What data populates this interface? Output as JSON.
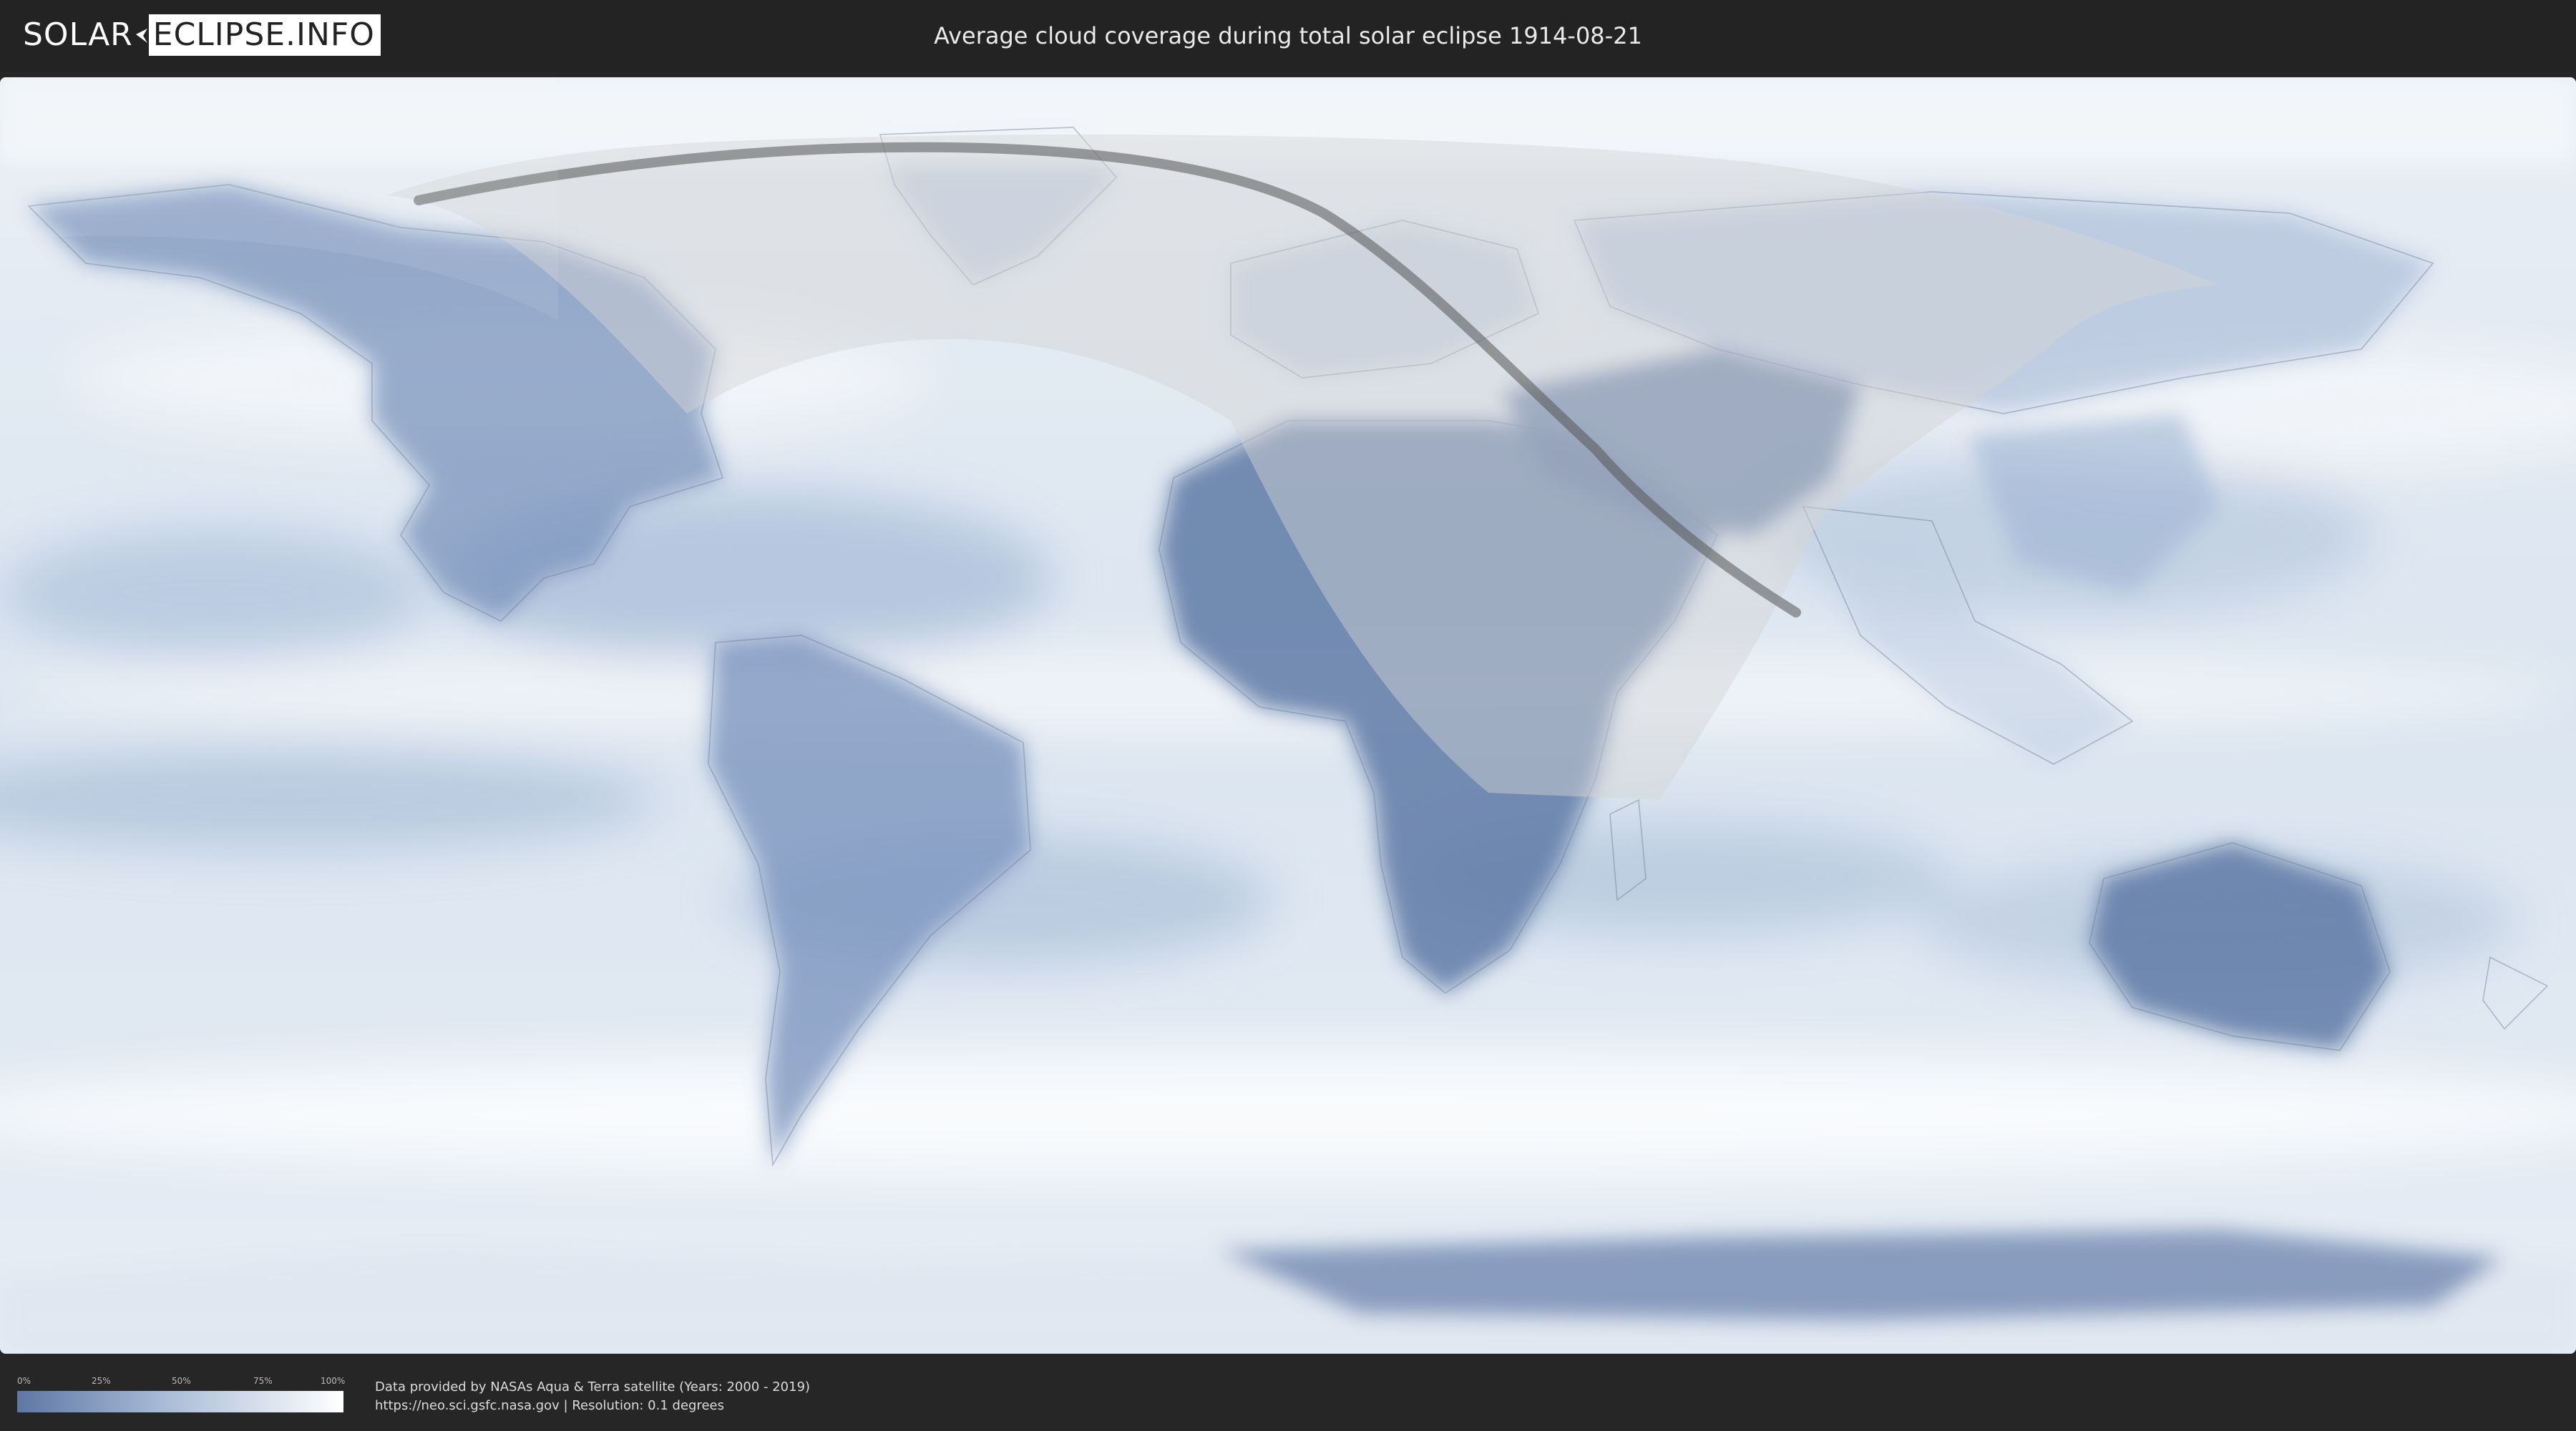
{
  "header": {
    "logo_solar": "SOLAR",
    "logo_eclipse": "ECLIPSE.INFO",
    "title": "Average cloud coverage during total solar eclipse 1914-08-21"
  },
  "map": {
    "projection": "equirectangular",
    "ocean_colour": "#dfe8f2",
    "clear_sky_colour": "#5e77a4",
    "cloud_colour": "#ffffff",
    "eclipse_path_colour": "#555555",
    "visibility_zone_colour": "#dcdcdc"
  },
  "legend": {
    "ticks": [
      "0%",
      "25%",
      "50%",
      "75%",
      "100%"
    ],
    "gradient_from": "#5e77a4",
    "gradient_to": "#ffffff"
  },
  "footer": {
    "credit_line": "Data provided by NASAs Aqua & Terra satellite (Years: 2000 - 2019)",
    "source_line": "https://neo.sci.gsfc.nasa.gov | Resolution: 0.1 degrees"
  }
}
